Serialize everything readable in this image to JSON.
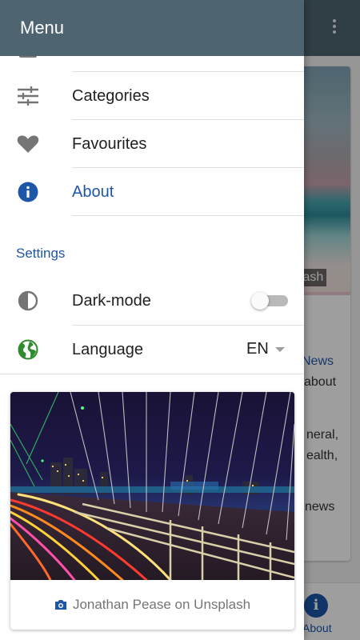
{
  "background_app": {
    "image_credit_fragment": "plash",
    "text_lines": [
      "News",
      "about",
      "neral,",
      "ealth,",
      "news"
    ],
    "bottom_nav": {
      "about_label": "About"
    }
  },
  "drawer": {
    "title": "Menu",
    "items": [
      {
        "label": "Categories",
        "icon": "tune-icon",
        "active": false
      },
      {
        "label": "Favourites",
        "icon": "heart-icon",
        "active": false
      },
      {
        "label": "About",
        "icon": "info-icon",
        "active": true
      }
    ],
    "settings": {
      "header": "Settings",
      "dark_mode": {
        "label": "Dark-mode",
        "icon": "contrast-icon",
        "enabled": false
      },
      "language": {
        "label": "Language",
        "icon": "globe-icon",
        "value": "EN"
      }
    },
    "photo": {
      "subject": "Brooklyn Bridge at night with light trails",
      "credit": "Jonathan Pease on Unsplash",
      "credit_icon": "camera-icon"
    }
  },
  "colors": {
    "app_bar": "#4e6470",
    "accent": "#1e56a8",
    "text": "#212121",
    "muted": "#757575"
  }
}
